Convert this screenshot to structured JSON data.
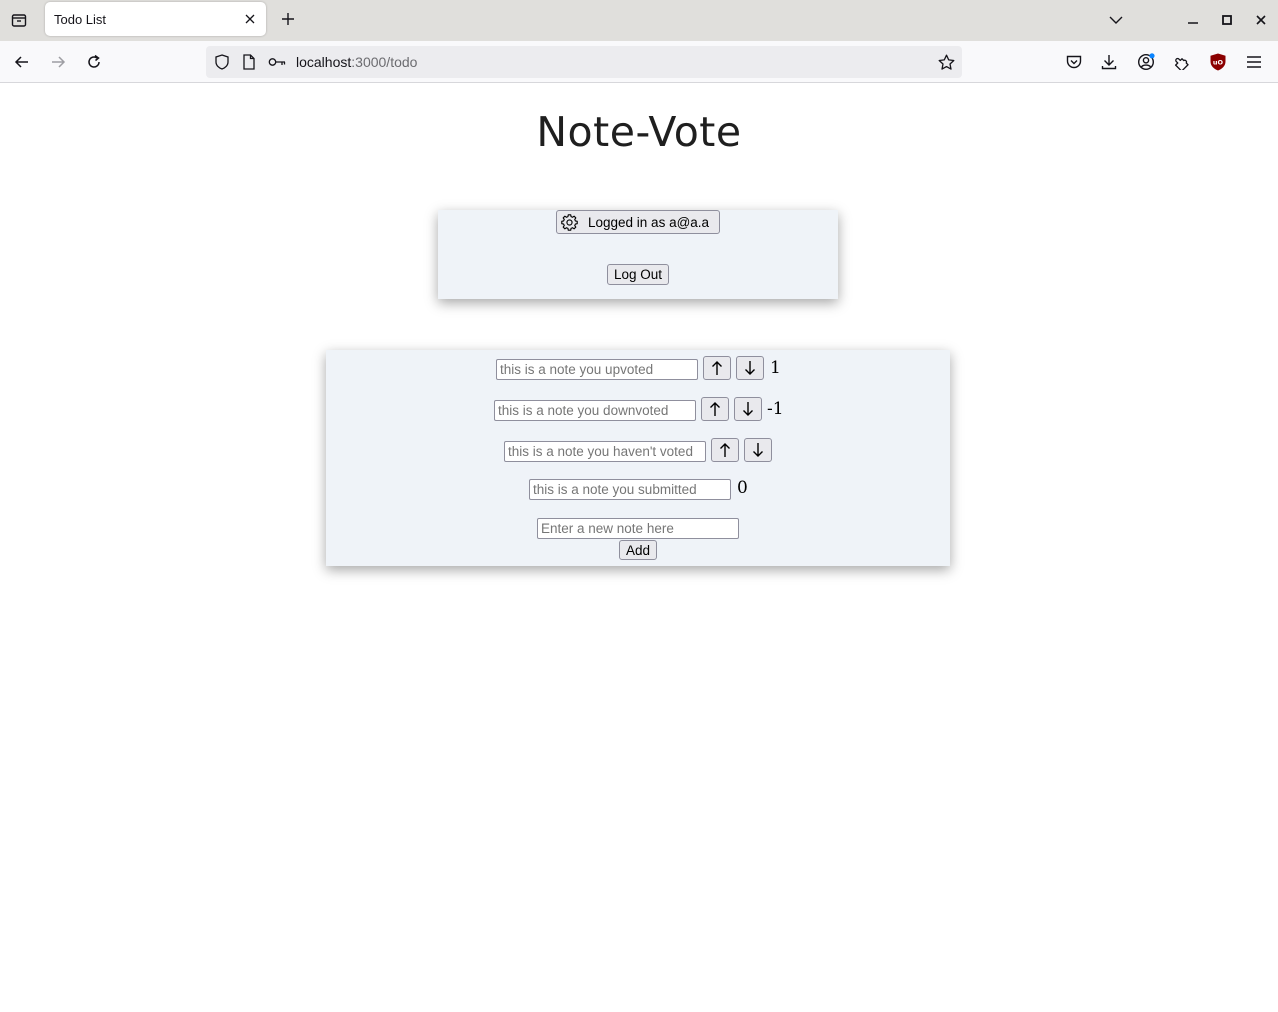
{
  "browser": {
    "tab_title": "Todo List",
    "url_host": "localhost",
    "url_path": ":3000/todo"
  },
  "page": {
    "title": "Note-Vote"
  },
  "user_panel": {
    "logged_in_label": "Logged in as a@a.a",
    "logout_label": "Log Out"
  },
  "notes": [
    {
      "placeholder": "this is a note you upvoted",
      "score": "1",
      "can_vote": true
    },
    {
      "placeholder": "this is a note you downvoted",
      "score": "-1",
      "can_vote": true
    },
    {
      "placeholder": "this is a note you haven't voted",
      "score": "",
      "can_vote": true
    },
    {
      "placeholder": "this is a note you submitted",
      "score": "0",
      "can_vote": false
    }
  ],
  "vote": {
    "up_symbol": "↑",
    "down_symbol": "↓"
  },
  "new_note": {
    "placeholder": "Enter a new note here",
    "add_label": "Add"
  },
  "colors": {
    "card_bg": "#eff3f8",
    "ublock_red": "#8b0000",
    "notification_dot": "#0a84ff"
  }
}
